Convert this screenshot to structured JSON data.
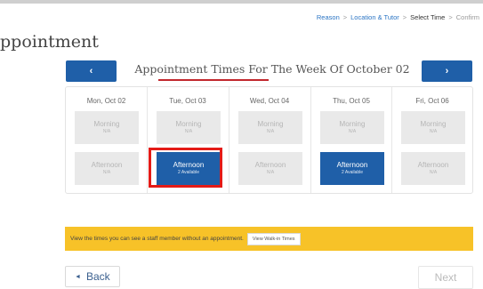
{
  "breadcrumb": {
    "items": [
      {
        "label": "Reason"
      },
      {
        "label": "Location & Tutor"
      },
      {
        "label": "Select Time"
      },
      {
        "label": "Confirm"
      }
    ],
    "separator": ">"
  },
  "page": {
    "title": "ppointment"
  },
  "week": {
    "heading": "Appointment Times For The Week Of October 02",
    "prev_label": "‹",
    "next_label": "›"
  },
  "days": [
    {
      "label": "Mon, Oct 02",
      "morning": {
        "title": "Morning",
        "sub": "N/A",
        "available": false
      },
      "afternoon": {
        "title": "Afternoon",
        "sub": "N/A",
        "available": false
      }
    },
    {
      "label": "Tue, Oct 03",
      "morning": {
        "title": "Morning",
        "sub": "N/A",
        "available": false
      },
      "afternoon": {
        "title": "Afternoon",
        "sub": "2 Available",
        "available": true
      }
    },
    {
      "label": "Wed, Oct 04",
      "morning": {
        "title": "Morning",
        "sub": "N/A",
        "available": false
      },
      "afternoon": {
        "title": "Afternoon",
        "sub": "N/A",
        "available": false
      }
    },
    {
      "label": "Thu, Oct 05",
      "morning": {
        "title": "Morning",
        "sub": "N/A",
        "available": false
      },
      "afternoon": {
        "title": "Afternoon",
        "sub": "2 Available",
        "available": true
      }
    },
    {
      "label": "Fri, Oct 06",
      "morning": {
        "title": "Morning",
        "sub": "N/A",
        "available": false
      },
      "afternoon": {
        "title": "Afternoon",
        "sub": "N/A",
        "available": false
      }
    }
  ],
  "notice": {
    "text": "View the times you can see a staff member without an appointment.",
    "button_label": "View Walk-in Times"
  },
  "footer": {
    "back_icon": "◄",
    "back_label": "Back",
    "next_label": "Next"
  },
  "colors": {
    "primary": "#1f5fa8",
    "highlight": "#e41b17",
    "notice": "#f7c228",
    "underline": "#c2272d"
  }
}
